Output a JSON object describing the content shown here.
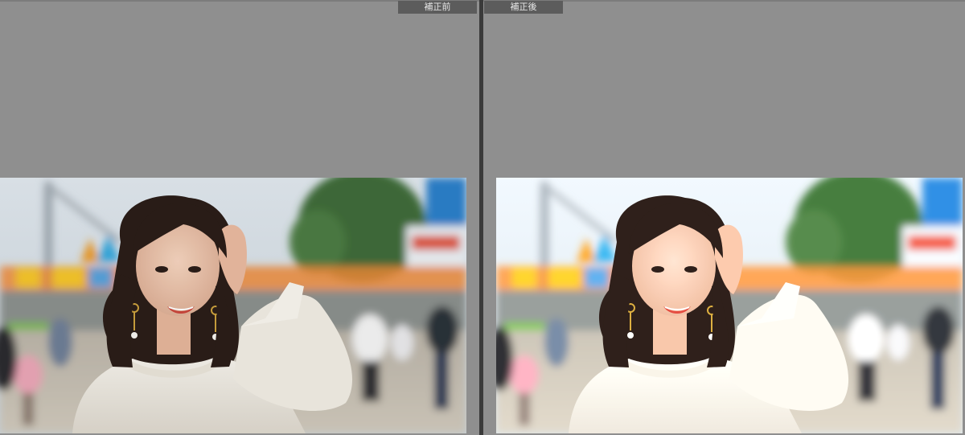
{
  "panes": {
    "before": {
      "label": "補正前"
    },
    "after": {
      "label": "補正後"
    }
  },
  "colors": {
    "background": "#8f8f8f",
    "divider": "#3a3a3a",
    "tab_bg": "#5c5c5c",
    "tab_text": "#e8e8e8"
  }
}
